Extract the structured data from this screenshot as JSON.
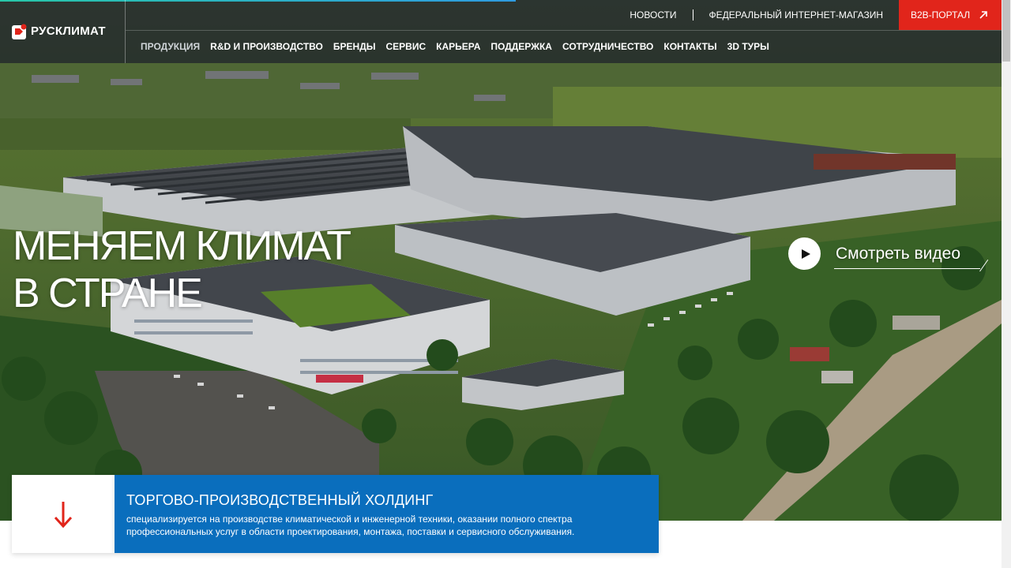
{
  "header": {
    "logo_text": "РУСКЛИМАТ",
    "top_links": {
      "news": "НОВОСТИ",
      "shop": "ФЕДЕРАЛЬНЫЙ ИНТЕРНЕТ-МАГАЗИН",
      "b2b": "B2B-ПОРТАЛ"
    },
    "nav": [
      "ПРОДУКЦИЯ",
      "R&D И ПРОИЗВОДСТВО",
      "БРЕНДЫ",
      "СЕРВИС",
      "КАРЬЕРА",
      "ПОДДЕРЖКА",
      "СОТРУДНИЧЕСТВО",
      "КОНТАКТЫ",
      "3D ТУРЫ"
    ]
  },
  "hero": {
    "headline_line1": "МЕНЯЕМ КЛИМАТ",
    "headline_line2": "В СТРАНЕ",
    "video_label": "Смотреть видео"
  },
  "info": {
    "title": "ТОРГОВО-ПРОИЗВОДСТВЕННЫЙ ХОЛДИНГ",
    "text": "специализируется на производстве климатической и инженерной техники, оказании полного спектра профессиональных услуг в области проектирования, монтажа, поставки и сервисного обслуживания."
  },
  "colors": {
    "accent_red": "#e1251b",
    "info_blue": "#0a6ebd",
    "header_bg": "#1c2228"
  },
  "icons": {
    "b2b": "arrow-up-right-icon",
    "video": "play-icon",
    "scroll": "arrow-down-icon"
  }
}
